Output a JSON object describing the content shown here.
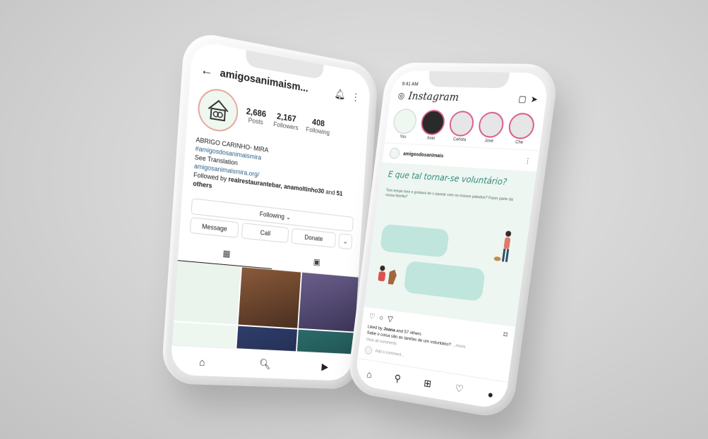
{
  "profile": {
    "username": "amigosanimaism...",
    "stats": [
      {
        "num": "2,686",
        "label": "Posts"
      },
      {
        "num": "2,167",
        "label": "Followers"
      },
      {
        "num": "408",
        "label": "Following"
      }
    ],
    "bio_name": "ABRIGO CARINHO- MIRA",
    "bio_tag": "#amigosdosanimaismira",
    "bio_translate": "See Translation",
    "bio_link": "amigosanimaismira.org/",
    "followed_prefix": "Followed by ",
    "followed_names": "realrestaurantebar, anamoltinho30",
    "followed_and": " and",
    "followed_others": "51 others",
    "following_btn": "Following ⌄",
    "buttons": [
      "Message",
      "Call",
      "Donate"
    ],
    "more_btn": "⌄"
  },
  "feed": {
    "time": "9:41 AM",
    "logo": "Instagram",
    "stories": [
      "You",
      "Joao",
      "Carlota",
      "José",
      "Che"
    ],
    "post_user": "amigosdosanimais",
    "post_title": "E que tal tornar-se voluntário?",
    "post_sub": "Tem tempo livre e gostava de o passar com os nossos patudos? Fazer parte da nossa família?",
    "liked_prefix": "Liked by ",
    "liked_name": "Joana",
    "liked_suffix": " and 57 others",
    "caption": "Sabe o coisa são as tarefas de um voluntário?",
    "caption_more": " ...more",
    "view_comments": "View all comments",
    "add_comment": "Add a comment..."
  },
  "colors": {
    "accent_teal": "#2f8a7a",
    "story_ring": "#d85b8f",
    "link_blue": "#2b5f86"
  }
}
